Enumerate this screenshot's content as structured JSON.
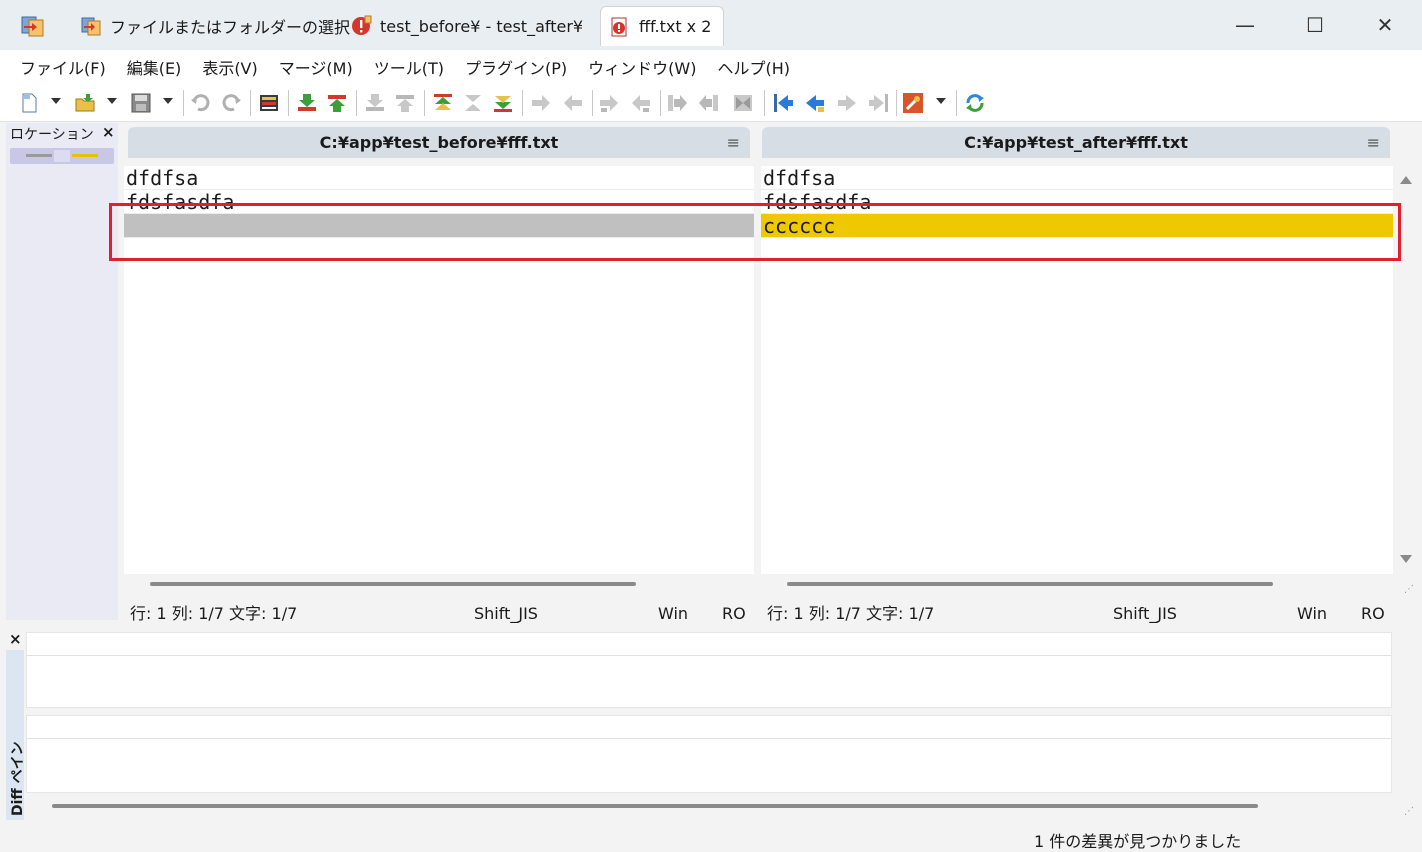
{
  "window": {
    "tabs": [
      {
        "label": "ファイルまたはフォルダーの選択",
        "icon": "compare-folder-icon"
      },
      {
        "label": "test_before¥ - test_after¥",
        "icon": "warning-compare-icon"
      },
      {
        "label": "fff.txt x 2",
        "icon": "text-compare-icon"
      }
    ],
    "controls": {
      "minimize": "—",
      "maximize": "☐",
      "close": "✕"
    }
  },
  "menu": [
    "ファイル(F)",
    "編集(E)",
    "表示(V)",
    "マージ(M)",
    "ツール(T)",
    "プラグイン(P)",
    "ウィンドウ(W)",
    "ヘルプ(H)"
  ],
  "location_pane": {
    "title": "ロケーション ペイン",
    "close": "×"
  },
  "left": {
    "path": "C:¥app¥test_before¥fff.txt",
    "lines": [
      "dfdfsa",
      "fdsfasdfa",
      ""
    ],
    "status": {
      "pos": "行: 1  列: 1/7  文字: 1/7",
      "encoding": "Shift_JIS",
      "eol": "Win",
      "mode": "RO"
    }
  },
  "right": {
    "path": "C:¥app¥test_after¥fff.txt",
    "lines": [
      "dfdfsa",
      "fdsfasdfa",
      "cccccc"
    ],
    "status": {
      "pos": "行: 1  列: 1/7  文字: 1/7",
      "encoding": "Shift_JIS",
      "eol": "Win",
      "mode": "RO"
    }
  },
  "diff_pane": {
    "title": "Diff ペイン",
    "close": "×"
  },
  "statusbar": {
    "message": "1 件の差異が見つかりました"
  },
  "hamburger": "≡",
  "colors": {
    "removed": "#c0c0c0",
    "added": "#eec800",
    "highlight": "#e0202e"
  }
}
